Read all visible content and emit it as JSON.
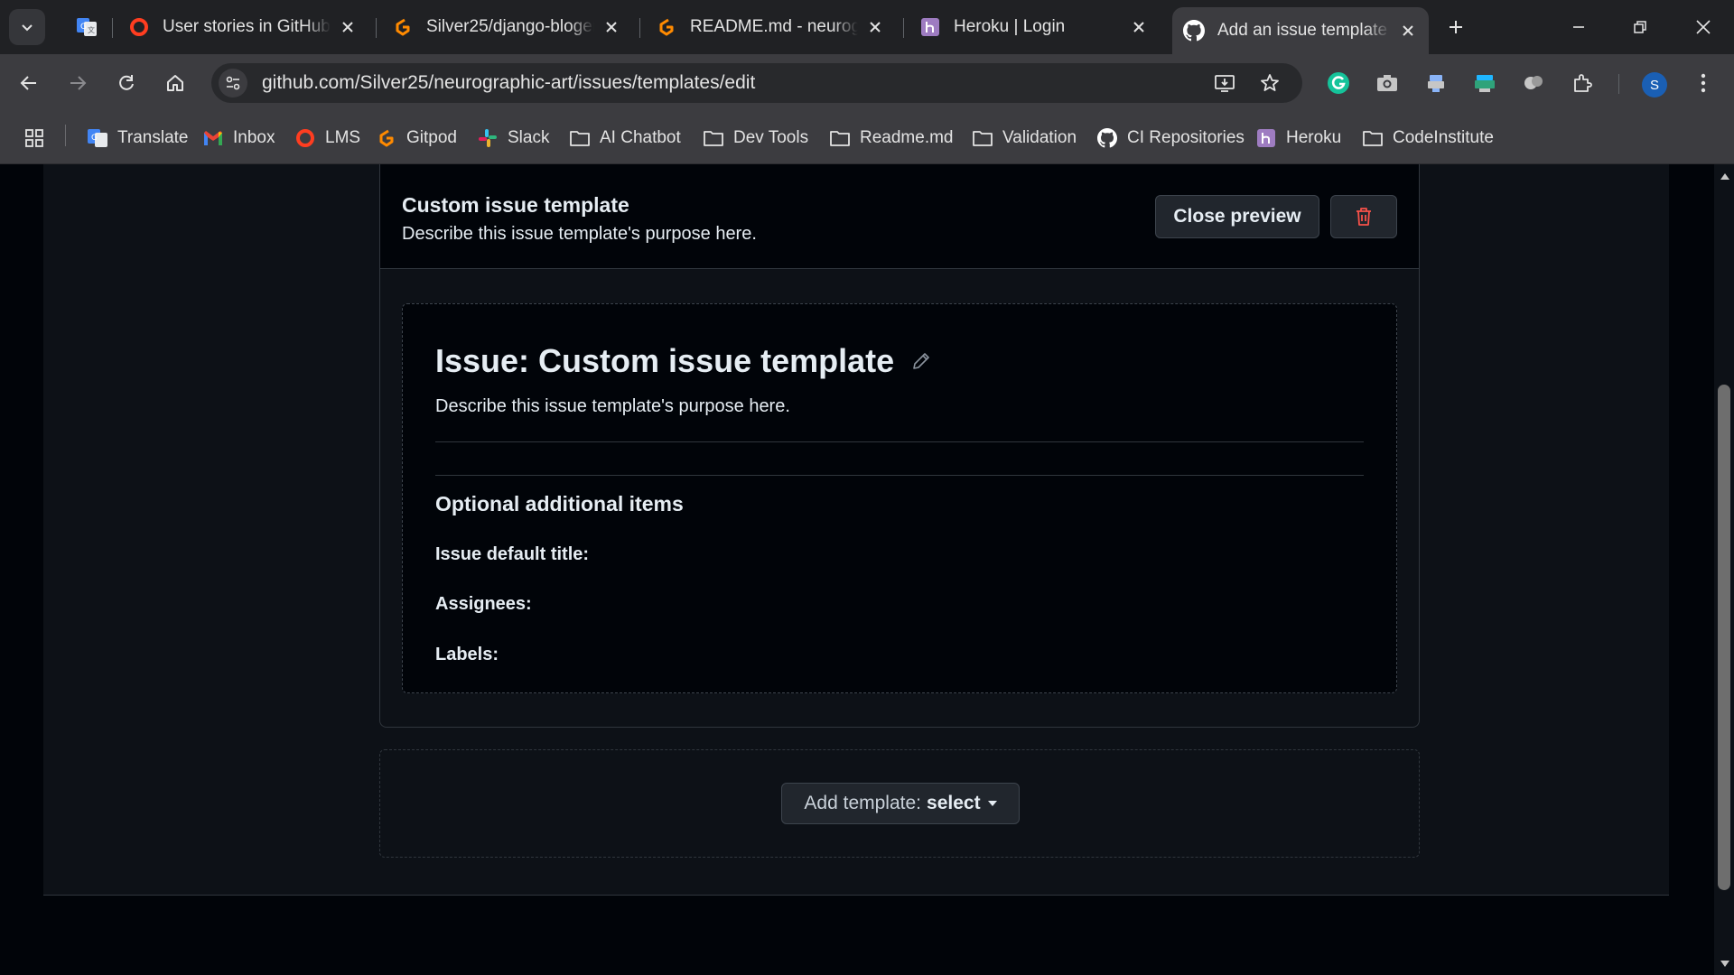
{
  "browser": {
    "tabs": [
      {
        "title": "User stories in GitHub P",
        "favicon": "opera-circle-icon"
      },
      {
        "title": "Silver25/django-bloger",
        "favicon": "gitpod-icon"
      },
      {
        "title": "README.md - neurogra",
        "favicon": "gitpod-icon"
      },
      {
        "title": "Heroku | Login",
        "favicon": "heroku-icon"
      },
      {
        "title": "Add an issue template t",
        "favicon": "github-icon",
        "active": true
      }
    ],
    "url": "github.com/Silver25/neurographic-art/issues/templates/edit",
    "profile_initial": "S",
    "bookmarks": [
      {
        "label": "Translate",
        "icon": "google-translate-icon"
      },
      {
        "label": "Inbox",
        "icon": "gmail-icon"
      },
      {
        "label": "LMS",
        "icon": "opera-circle-icon"
      },
      {
        "label": "Gitpod",
        "icon": "gitpod-icon"
      },
      {
        "label": "Slack",
        "icon": "slack-icon"
      },
      {
        "label": "AI Chatbot",
        "icon": "folder-icon"
      },
      {
        "label": "Dev Tools",
        "icon": "folder-icon"
      },
      {
        "label": "Readme.md",
        "icon": "folder-icon"
      },
      {
        "label": "Validation",
        "icon": "folder-icon"
      },
      {
        "label": "CI Repositories",
        "icon": "github-icon"
      },
      {
        "label": "Heroku",
        "icon": "heroku-icon"
      },
      {
        "label": "CodeInstitute",
        "icon": "folder-icon"
      }
    ]
  },
  "template": {
    "header_title": "Custom issue template",
    "header_description": "Describe this issue template's purpose here.",
    "close_preview_label": "Close preview",
    "preview": {
      "title": "Issue: Custom issue template",
      "description": "Describe this issue template's purpose here.",
      "optional_heading": "Optional additional items",
      "field_default_title": "Issue default title:",
      "field_assignees": "Assignees:",
      "field_labels": "Labels:"
    }
  },
  "add_template": {
    "prefix": "Add template:",
    "value": "select"
  },
  "colors": {
    "page_bg": "#0d1117",
    "canvas_bg": "#010409",
    "border": "#30363d",
    "danger": "#f85149",
    "text": "#e6edf3"
  }
}
